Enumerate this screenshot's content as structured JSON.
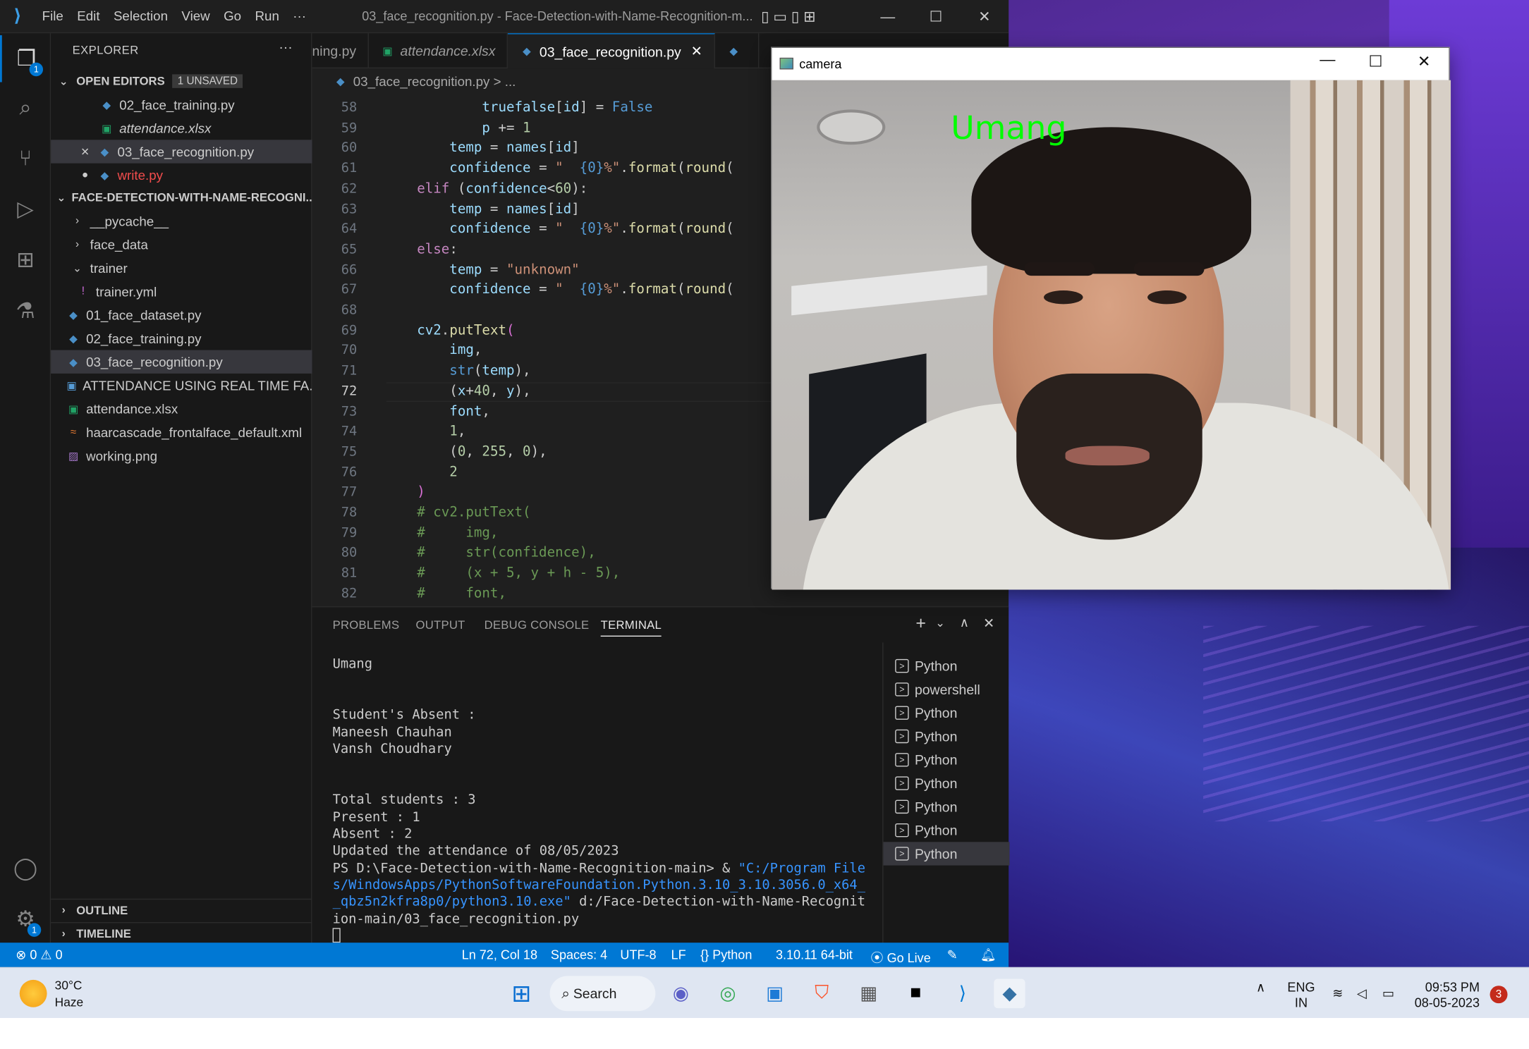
{
  "titlebar": {
    "menus": [
      "File",
      "Edit",
      "Selection",
      "View",
      "Go",
      "Run",
      "···"
    ],
    "title": "03_face_recognition.py - Face-Detection-with-Name-Recognition-m..."
  },
  "activity": {
    "explorer_badge": "1",
    "settings_badge": "1"
  },
  "sidebar": {
    "header": "EXPLORER",
    "more": "···",
    "open_editors": {
      "label": "OPEN EDITORS",
      "badge": "1 UNSAVED",
      "items": [
        {
          "label": "02_face_training.py"
        },
        {
          "label": "attendance.xlsx"
        },
        {
          "label": "03_face_recognition.py"
        },
        {
          "label": "write.py"
        }
      ]
    },
    "folder": {
      "label": "FACE-DETECTION-WITH-NAME-RECOGNI...",
      "items": [
        {
          "label": "__pycache__"
        },
        {
          "label": "face_data"
        },
        {
          "label": "trainer"
        },
        {
          "label": "trainer.yml"
        },
        {
          "label": "01_face_dataset.py"
        },
        {
          "label": "02_face_training.py"
        },
        {
          "label": "03_face_recognition.py"
        },
        {
          "label": "ATTENDANCE USING REAL TIME FA..."
        },
        {
          "label": "attendance.xlsx"
        },
        {
          "label": "haarcascade_frontalface_default.xml"
        },
        {
          "label": "working.png"
        }
      ]
    },
    "outline": "OUTLINE",
    "timeline": "TIMELINE"
  },
  "tabs": [
    {
      "label": "ning.py"
    },
    {
      "label": "attendance.xlsx"
    },
    {
      "label": "03_face_recognition.py"
    }
  ],
  "breadcrumb": {
    "file": "03_face_recognition.py",
    "tail": "> ..."
  },
  "editor": {
    "current_line": "72",
    "lines": [
      {
        "n": "58",
        "html": "            <span class=\"v\">truefalse</span>[<span class=\"v\">id</span>] = <span class=\"b\">False</span>"
      },
      {
        "n": "59",
        "html": "            <span class=\"v\">p</span> += <span class=\"n\">1</span>"
      },
      {
        "n": "60",
        "html": "        <span class=\"v\">temp</span> = <span class=\"v\">names</span>[<span class=\"v\">id</span>]"
      },
      {
        "n": "61",
        "html": "        <span class=\"v\">confidence</span> = <span class=\"s\">\"  </span><span class=\"b\">{0}</span><span class=\"s\">%\"</span>.<span class=\"f\">format</span>(<span class=\"f\">round</span>("
      },
      {
        "n": "62",
        "html": "    <span class=\"k\">elif</span> (<span class=\"v\">confidence</span>&lt;<span class=\"n\">60</span>):"
      },
      {
        "n": "63",
        "html": "        <span class=\"v\">temp</span> = <span class=\"v\">names</span>[<span class=\"v\">id</span>]"
      },
      {
        "n": "64",
        "html": "        <span class=\"v\">confidence</span> = <span class=\"s\">\"  </span><span class=\"b\">{0}</span><span class=\"s\">%\"</span>.<span class=\"f\">format</span>(<span class=\"f\">round</span>("
      },
      {
        "n": "65",
        "html": "    <span class=\"k\">else</span>:"
      },
      {
        "n": "66",
        "html": "        <span class=\"v\">temp</span> = <span class=\"s\">\"unknown\"</span>"
      },
      {
        "n": "67",
        "html": "        <span class=\"v\">confidence</span> = <span class=\"s\">\"  </span><span class=\"b\">{0}</span><span class=\"s\">%\"</span>.<span class=\"f\">format</span>(<span class=\"f\">round</span>("
      },
      {
        "n": "68",
        "html": ""
      },
      {
        "n": "69",
        "html": "    <span class=\"v\">cv2</span>.<span class=\"f\">putText</span><span class=\"p\">(</span>"
      },
      {
        "n": "70",
        "html": "        <span class=\"v\">img</span>,"
      },
      {
        "n": "71",
        "html": "        <span class=\"b\">str</span>(<span class=\"v\">temp</span>),"
      },
      {
        "n": "72",
        "html": "        (<span class=\"v\">x</span>+<span class=\"n\">40</span>, <span class=\"v\">y</span>),"
      },
      {
        "n": "73",
        "html": "        <span class=\"v\">font</span>,"
      },
      {
        "n": "74",
        "html": "        <span class=\"n\">1</span>,"
      },
      {
        "n": "75",
        "html": "        (<span class=\"n\">0</span>, <span class=\"n\">255</span>, <span class=\"n\">0</span>),"
      },
      {
        "n": "76",
        "html": "        <span class=\"n\">2</span>"
      },
      {
        "n": "77",
        "html": "    <span class=\"p\">)</span>"
      },
      {
        "n": "78",
        "html": "    <span class=\"c\"># cv2.putText(</span>"
      },
      {
        "n": "79",
        "html": "    <span class=\"c\">#     img,</span>"
      },
      {
        "n": "80",
        "html": "    <span class=\"c\">#     str(confidence),</span>"
      },
      {
        "n": "81",
        "html": "    <span class=\"c\">#     (x + 5, y + h - 5),</span>"
      },
      {
        "n": "82",
        "html": "    <span class=\"c\">#     font,</span>"
      }
    ]
  },
  "panel": {
    "tabs": [
      "PROBLEMS",
      "OUTPUT",
      "DEBUG CONSOLE",
      "TERMINAL"
    ],
    "terminal_lines": [
      "Umang",
      "",
      "",
      "Student's Absent :",
      "Maneesh Chauhan",
      "Vansh Choudhary",
      "",
      "",
      "Total students : 3",
      "Present : 1",
      "Absent : 2",
      "Updated the attendance of 08/05/2023"
    ],
    "prompt": "PS D:\\Face-Detection-with-Name-Recognition-main> & ",
    "exe_path": "\"C:/Program File",
    "exe_path2": "s/WindowsApps/PythonSoftwareFoundation.Python.3.10_3.10.3056.0_x64_",
    "exe_path3": "_qbz5n2kfra8p0/python3.10.exe\"",
    "arg": " d:/Face-Detection-with-Name-Recognit",
    "arg2": "ion-main/03_face_recognition.py",
    "terminals": [
      "Python",
      "powershell",
      "Python",
      "Python",
      "Python",
      "Python",
      "Python",
      "Python",
      "Python"
    ]
  },
  "status": {
    "errors": "0",
    "warnings": "0",
    "position": "Ln 72, Col 18",
    "spaces": "Spaces: 4",
    "encoding": "UTF-8",
    "eol": "LF",
    "language": "Python",
    "interpreter": "3.10.11 64-bit",
    "golive": "Go Live"
  },
  "camera": {
    "title": "camera",
    "label": "Umang"
  },
  "taskbar": {
    "temp": "30°C",
    "weather": "Haze",
    "search": "Search",
    "lang1": "ENG",
    "lang2": "IN",
    "time": "09:53 PM",
    "date": "08-05-2023",
    "notif": "3"
  }
}
